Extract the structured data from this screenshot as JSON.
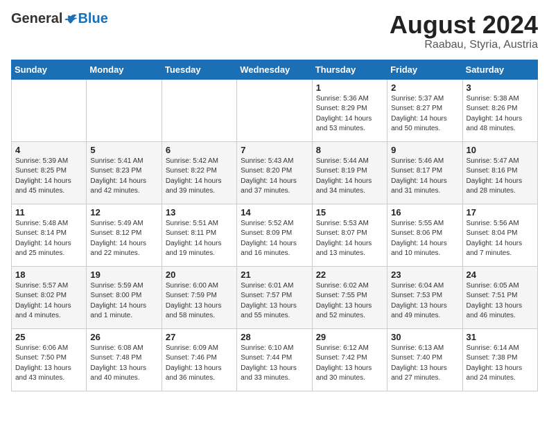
{
  "header": {
    "logo_general": "General",
    "logo_blue": "Blue",
    "month_title": "August 2024",
    "subtitle": "Raabau, Styria, Austria"
  },
  "days_of_week": [
    "Sunday",
    "Monday",
    "Tuesday",
    "Wednesday",
    "Thursday",
    "Friday",
    "Saturday"
  ],
  "weeks": [
    [
      {
        "day": "",
        "info": ""
      },
      {
        "day": "",
        "info": ""
      },
      {
        "day": "",
        "info": ""
      },
      {
        "day": "",
        "info": ""
      },
      {
        "day": "1",
        "info": "Sunrise: 5:36 AM\nSunset: 8:29 PM\nDaylight: 14 hours\nand 53 minutes."
      },
      {
        "day": "2",
        "info": "Sunrise: 5:37 AM\nSunset: 8:27 PM\nDaylight: 14 hours\nand 50 minutes."
      },
      {
        "day": "3",
        "info": "Sunrise: 5:38 AM\nSunset: 8:26 PM\nDaylight: 14 hours\nand 48 minutes."
      }
    ],
    [
      {
        "day": "4",
        "info": "Sunrise: 5:39 AM\nSunset: 8:25 PM\nDaylight: 14 hours\nand 45 minutes."
      },
      {
        "day": "5",
        "info": "Sunrise: 5:41 AM\nSunset: 8:23 PM\nDaylight: 14 hours\nand 42 minutes."
      },
      {
        "day": "6",
        "info": "Sunrise: 5:42 AM\nSunset: 8:22 PM\nDaylight: 14 hours\nand 39 minutes."
      },
      {
        "day": "7",
        "info": "Sunrise: 5:43 AM\nSunset: 8:20 PM\nDaylight: 14 hours\nand 37 minutes."
      },
      {
        "day": "8",
        "info": "Sunrise: 5:44 AM\nSunset: 8:19 PM\nDaylight: 14 hours\nand 34 minutes."
      },
      {
        "day": "9",
        "info": "Sunrise: 5:46 AM\nSunset: 8:17 PM\nDaylight: 14 hours\nand 31 minutes."
      },
      {
        "day": "10",
        "info": "Sunrise: 5:47 AM\nSunset: 8:16 PM\nDaylight: 14 hours\nand 28 minutes."
      }
    ],
    [
      {
        "day": "11",
        "info": "Sunrise: 5:48 AM\nSunset: 8:14 PM\nDaylight: 14 hours\nand 25 minutes."
      },
      {
        "day": "12",
        "info": "Sunrise: 5:49 AM\nSunset: 8:12 PM\nDaylight: 14 hours\nand 22 minutes."
      },
      {
        "day": "13",
        "info": "Sunrise: 5:51 AM\nSunset: 8:11 PM\nDaylight: 14 hours\nand 19 minutes."
      },
      {
        "day": "14",
        "info": "Sunrise: 5:52 AM\nSunset: 8:09 PM\nDaylight: 14 hours\nand 16 minutes."
      },
      {
        "day": "15",
        "info": "Sunrise: 5:53 AM\nSunset: 8:07 PM\nDaylight: 14 hours\nand 13 minutes."
      },
      {
        "day": "16",
        "info": "Sunrise: 5:55 AM\nSunset: 8:06 PM\nDaylight: 14 hours\nand 10 minutes."
      },
      {
        "day": "17",
        "info": "Sunrise: 5:56 AM\nSunset: 8:04 PM\nDaylight: 14 hours\nand 7 minutes."
      }
    ],
    [
      {
        "day": "18",
        "info": "Sunrise: 5:57 AM\nSunset: 8:02 PM\nDaylight: 14 hours\nand 4 minutes."
      },
      {
        "day": "19",
        "info": "Sunrise: 5:59 AM\nSunset: 8:00 PM\nDaylight: 14 hours\nand 1 minute."
      },
      {
        "day": "20",
        "info": "Sunrise: 6:00 AM\nSunset: 7:59 PM\nDaylight: 13 hours\nand 58 minutes."
      },
      {
        "day": "21",
        "info": "Sunrise: 6:01 AM\nSunset: 7:57 PM\nDaylight: 13 hours\nand 55 minutes."
      },
      {
        "day": "22",
        "info": "Sunrise: 6:02 AM\nSunset: 7:55 PM\nDaylight: 13 hours\nand 52 minutes."
      },
      {
        "day": "23",
        "info": "Sunrise: 6:04 AM\nSunset: 7:53 PM\nDaylight: 13 hours\nand 49 minutes."
      },
      {
        "day": "24",
        "info": "Sunrise: 6:05 AM\nSunset: 7:51 PM\nDaylight: 13 hours\nand 46 minutes."
      }
    ],
    [
      {
        "day": "25",
        "info": "Sunrise: 6:06 AM\nSunset: 7:50 PM\nDaylight: 13 hours\nand 43 minutes."
      },
      {
        "day": "26",
        "info": "Sunrise: 6:08 AM\nSunset: 7:48 PM\nDaylight: 13 hours\nand 40 minutes."
      },
      {
        "day": "27",
        "info": "Sunrise: 6:09 AM\nSunset: 7:46 PM\nDaylight: 13 hours\nand 36 minutes."
      },
      {
        "day": "28",
        "info": "Sunrise: 6:10 AM\nSunset: 7:44 PM\nDaylight: 13 hours\nand 33 minutes."
      },
      {
        "day": "29",
        "info": "Sunrise: 6:12 AM\nSunset: 7:42 PM\nDaylight: 13 hours\nand 30 minutes."
      },
      {
        "day": "30",
        "info": "Sunrise: 6:13 AM\nSunset: 7:40 PM\nDaylight: 13 hours\nand 27 minutes."
      },
      {
        "day": "31",
        "info": "Sunrise: 6:14 AM\nSunset: 7:38 PM\nDaylight: 13 hours\nand 24 minutes."
      }
    ]
  ]
}
